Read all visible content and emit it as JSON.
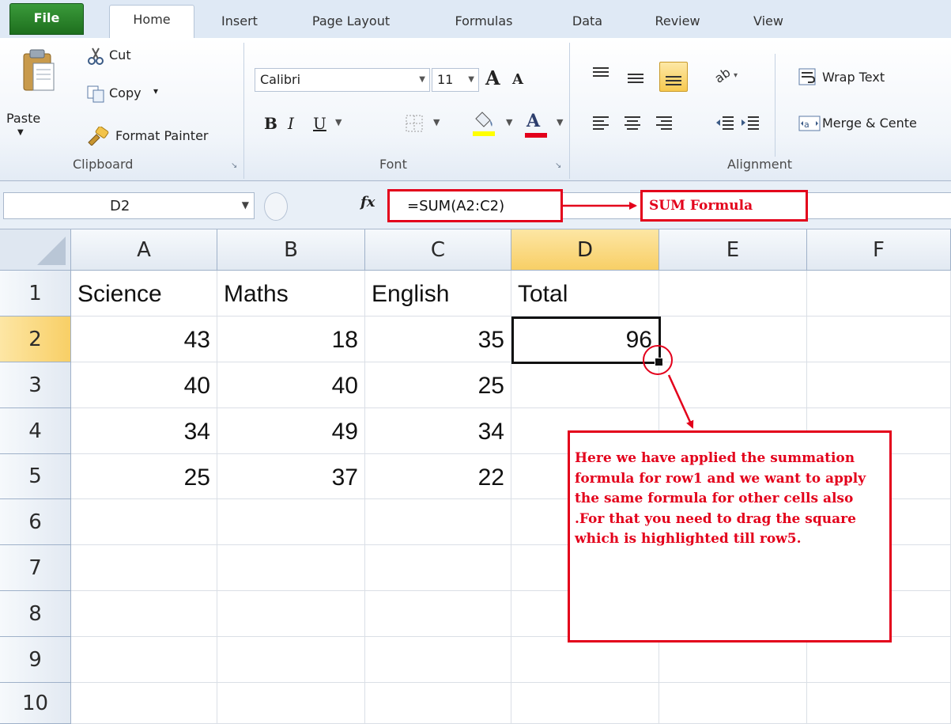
{
  "ribbon_tabs": [
    "File",
    "Home",
    "Insert",
    "Page Layout",
    "Formulas",
    "Data",
    "Review",
    "View"
  ],
  "clipboard": {
    "paste": "Paste",
    "cut": "Cut",
    "copy": "Copy",
    "copy_dropdown": "▾",
    "format_painter": "Format Painter",
    "label": "Clipboard"
  },
  "font": {
    "family": "Calibri",
    "size": "11",
    "grow": "A",
    "shrink": "A",
    "bold": "B",
    "italic": "I",
    "underline": "U",
    "font_color_letter": "A",
    "label": "Font"
  },
  "alignment": {
    "wrap_text": "Wrap Text",
    "merge_center": "Merge & Cente",
    "label": "Alignment"
  },
  "formula_bar": {
    "name_box": "D2",
    "fx": "fx",
    "formula": "=SUM(A2:C2)"
  },
  "callouts": {
    "sum_label": "SUM Formula",
    "note": "Here we have applied the summation formula for row1 and we want to apply the same formula for other cells also .For that you need to drag the square which is highlighted till row5."
  },
  "grid": {
    "columns": [
      "A",
      "B",
      "C",
      "D",
      "E",
      "F"
    ],
    "rows": [
      "1",
      "2",
      "3",
      "4",
      "5",
      "6",
      "7",
      "8",
      "9",
      "10"
    ],
    "selected_column": "D",
    "selected_row": "2",
    "cells": [
      [
        "Science",
        "Maths",
        "English",
        "Total",
        "",
        ""
      ],
      [
        "43",
        "18",
        "35",
        "96",
        "",
        ""
      ],
      [
        "40",
        "40",
        "25",
        "",
        "",
        ""
      ],
      [
        "34",
        "49",
        "34",
        "",
        "",
        ""
      ],
      [
        "25",
        "37",
        "22",
        "",
        "",
        ""
      ],
      [
        "",
        "",
        "",
        "",
        "",
        ""
      ],
      [
        "",
        "",
        "",
        "",
        "",
        ""
      ],
      [
        "",
        "",
        "",
        "",
        "",
        ""
      ],
      [
        "",
        "",
        "",
        "",
        "",
        ""
      ],
      [
        "",
        "",
        "",
        "",
        "",
        ""
      ]
    ]
  },
  "colors": {
    "annotation_red": "#e3001b",
    "file_tab_green": "#2e8b2e",
    "selected_header": "#f8cf66"
  }
}
